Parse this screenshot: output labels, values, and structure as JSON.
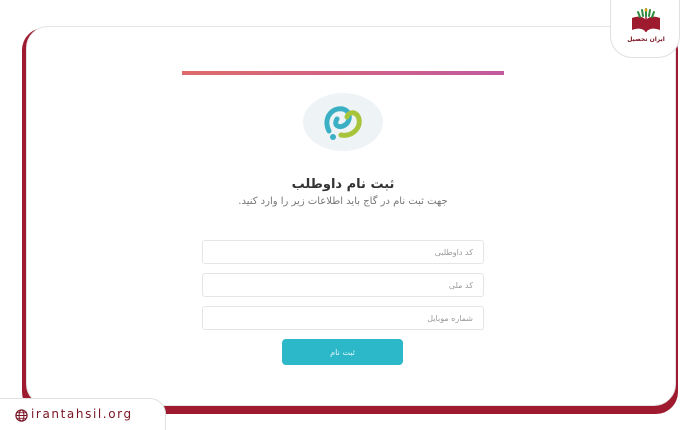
{
  "watermark": {
    "site": "irantahsil.org",
    "brand_name": "ایران تحصیل"
  },
  "form": {
    "title": "ثبت نام داوطلب",
    "subtitle": "جهت ثبت نام در گاج باید اطلاعات زیر را وارد کنید.",
    "fields": [
      {
        "placeholder": "کد داوطلبی",
        "value": ""
      },
      {
        "placeholder": "کد ملی",
        "value": ""
      },
      {
        "placeholder": "شماره موبایل",
        "value": ""
      }
    ],
    "submit_label": "ثبت نام"
  },
  "icons": {
    "logo": "gaj-logo-icon",
    "globe": "globe-icon",
    "brand": "book-logo-icon"
  },
  "colors": {
    "accent": "#2db8c9",
    "brand": "#9e1b2f",
    "top_bar_start": "#e06a6a",
    "top_bar_end": "#c25aa0",
    "logo_green": "#a8c43a",
    "logo_teal": "#3bb0c4"
  }
}
